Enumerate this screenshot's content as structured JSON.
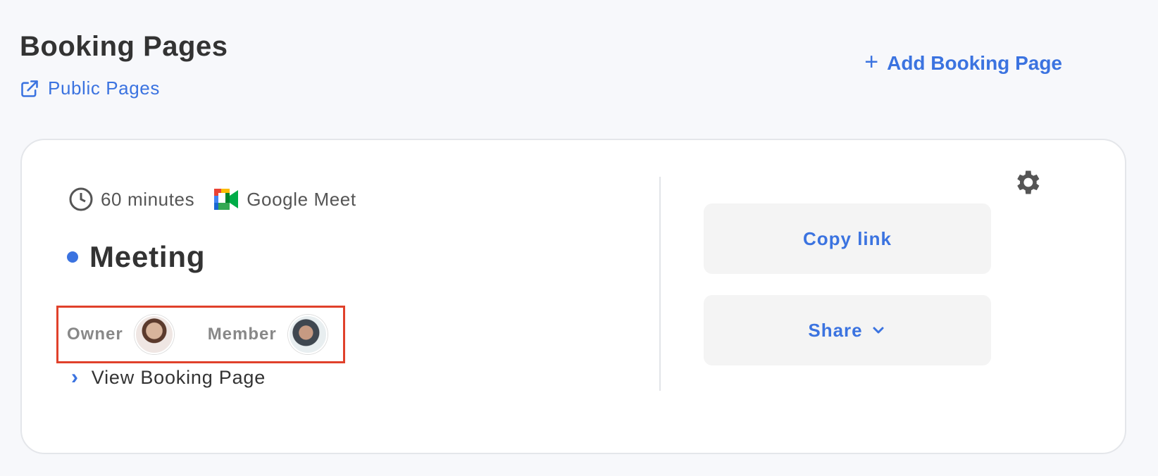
{
  "header": {
    "title": "Booking Pages",
    "public_pages_label": "Public Pages",
    "add_button_label": "Add Booking Page"
  },
  "booking_card": {
    "duration": "60 minutes",
    "conferencing": "Google Meet",
    "title": "Meeting",
    "owner_label": "Owner",
    "member_label": "Member",
    "view_link_label": "View Booking Page",
    "copy_link_label": "Copy link",
    "share_label": "Share"
  },
  "icons": {
    "external_link": "external-link-icon",
    "plus": "plus-icon",
    "clock": "clock-icon",
    "google_meet": "google-meet-icon",
    "chevron_right": "chevron-right-icon",
    "chevron_down": "chevron-down-icon",
    "settings": "gear-icon"
  },
  "colors": {
    "accent": "#3b73e0",
    "highlight_border": "#e0412b",
    "background": "#f7f8fb"
  }
}
